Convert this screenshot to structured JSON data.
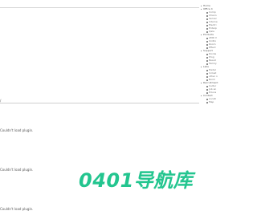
{
  "nav": {
    "items": [
      {
        "label": "Home",
        "children": []
      },
      {
        "label": "Office 4",
        "children": [
          "Comp",
          "Chann",
          "Server",
          "Interne",
          "Electri",
          "Enterp",
          "Qala"
        ]
      },
      {
        "label": "Products",
        "children": [
          "AMD V",
          "UniDo",
          "Room",
          "Effect"
        ]
      },
      {
        "label": "Support",
        "children": [
          "Docke",
          "Prog",
          "Beaut",
          "Family"
        ]
      },
      {
        "label": "Labs",
        "children": [
          "Hadal",
          "Indust",
          "other n",
          "Norm"
        ]
      },
      {
        "label": "Recruitment",
        "children": [
          "Cultur",
          "Job an",
          "Educa"
        ]
      },
      {
        "label": "Contact",
        "children": [
          "Locati",
          "Map"
        ]
      }
    ]
  },
  "content": {
    "divider_mark": "/",
    "plugin_messages": [
      "Couldn't load plugin.",
      "Couldn't load plugin.",
      "Couldn't load plugin."
    ]
  },
  "logo": {
    "text": "0401导航库",
    "color": "#23c58f"
  }
}
